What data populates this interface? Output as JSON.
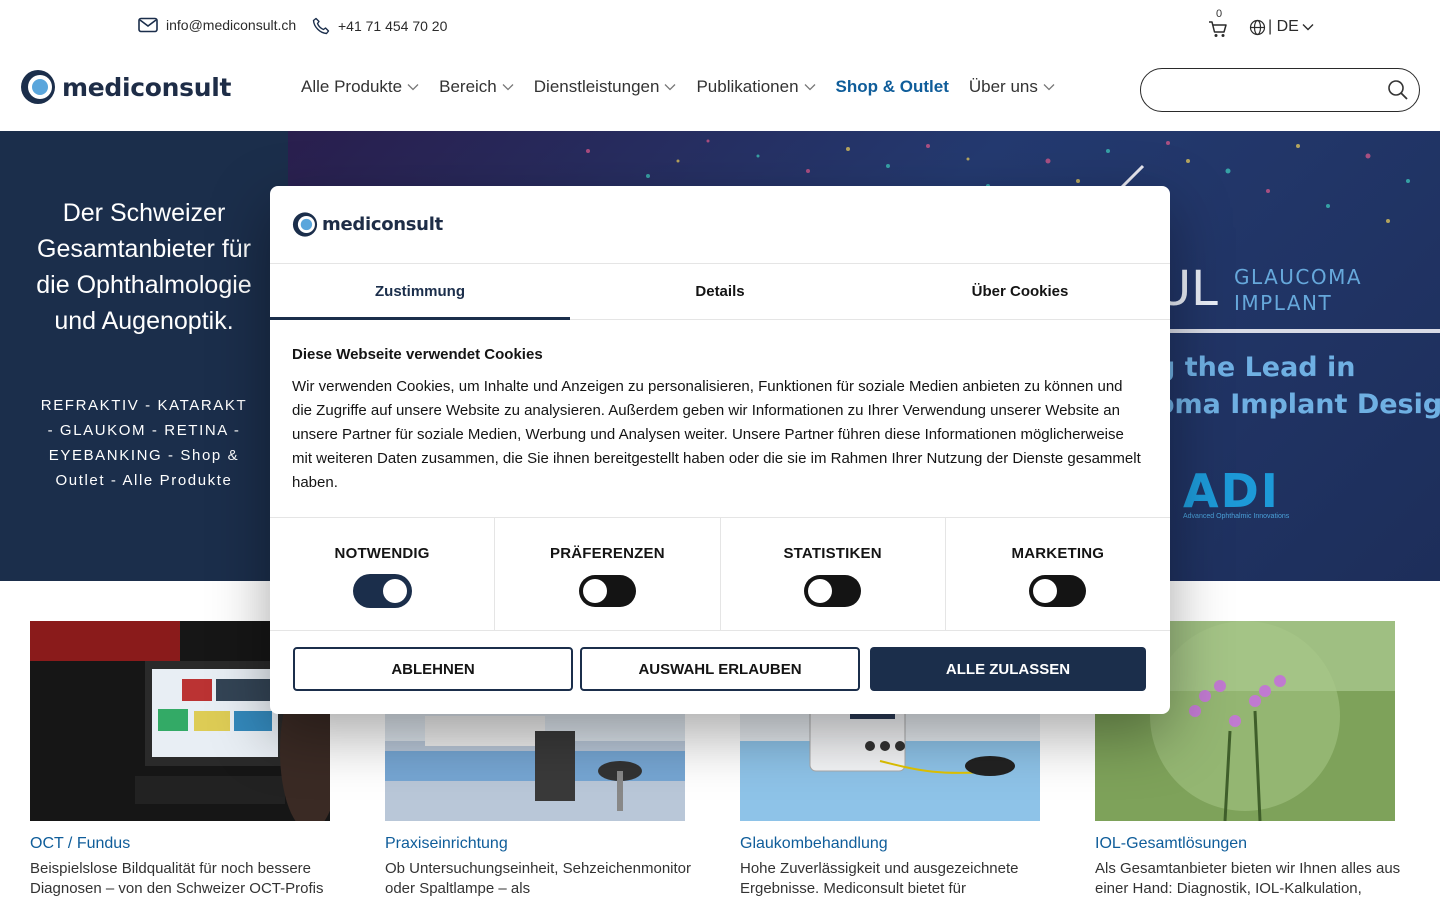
{
  "topbar": {
    "email": "info@mediconsult.ch",
    "phone": "+41 71 454 70 20",
    "cart_count": "0",
    "language": "| DE"
  },
  "brand": {
    "name": "mediconsult"
  },
  "nav": {
    "items": [
      {
        "label": "Alle Produkte"
      },
      {
        "label": "Bereich"
      },
      {
        "label": "Dienstleistungen"
      },
      {
        "label": "Publikationen"
      },
      {
        "label": "Shop & Outlet"
      },
      {
        "label": "Über uns"
      }
    ]
  },
  "hero": {
    "title": "Der Schweizer Gesamtanbieter für die Ophthalmologie und Augenoptik.",
    "subtitle": "REFRAKTIV - KATARAKT - GLAUKOM - RETINA - EYEBANKING - Shop & Outlet - Alle Produkte",
    "banner": {
      "ul": "UL",
      "glaucoma_1": "GLAUCOMA",
      "glaucoma_2": "IMPLANT",
      "lead_1": "g the Lead in",
      "lead_2": "oma Implant Design",
      "adi": "ADI",
      "adi_sub": "Advanced Ophthalmic Innovations"
    }
  },
  "cards": [
    {
      "title": "OCT / Fundus",
      "desc": "Beispielslose Bildqualität für noch bessere Diagnosen – von den Schweizer OCT-Profis"
    },
    {
      "title": "Praxiseinrichtung",
      "desc": "Ob Untersuchungseinheit, Sehzeichenmonitor oder Spaltlampe – als"
    },
    {
      "title": "Glaukombehandlung",
      "desc": "Hohe Zuverlässigkeit und ausgezeichnete Ergebnisse. Mediconsult bietet für"
    },
    {
      "title": "IOL-Gesamtlösungen",
      "desc": "Als Gesamtanbieter bieten wir Ihnen alles aus einer Hand: Diagnostik, IOL-Kalkulation,"
    }
  ],
  "cookie_dialog": {
    "tabs": [
      {
        "label": "Zustimmung"
      },
      {
        "label": "Details"
      },
      {
        "label": "Über Cookies"
      }
    ],
    "heading": "Diese Webseite verwendet Cookies",
    "body": "Wir verwenden Cookies, um Inhalte und Anzeigen zu personalisieren, Funktionen für soziale Medien anbieten zu können und die Zugriffe auf unsere Website zu analysieren. Außerdem geben wir Informationen zu Ihrer Verwendung unserer Website an unsere Partner für soziale Medien, Werbung und Analysen weiter. Unsere Partner führen diese Informationen möglicherweise mit weiteren Daten zusammen, die Sie ihnen bereitgestellt haben oder die sie im Rahmen Ihrer Nutzung der Dienste gesammelt haben.",
    "categories": [
      {
        "label": "NOTWENDIG",
        "enabled": true
      },
      {
        "label": "PRÄFERENZEN",
        "enabled": false
      },
      {
        "label": "STATISTIKEN",
        "enabled": false
      },
      {
        "label": "MARKETING",
        "enabled": false
      }
    ],
    "buttons": {
      "decline": "ABLEHNEN",
      "allow_selection": "AUSWAHL ERLAUBEN",
      "allow_all": "ALLE ZULASSEN"
    }
  },
  "colors": {
    "navy": "#1b2e4b",
    "link_blue": "#0f5d9a",
    "accent_blue": "#66a8db"
  }
}
